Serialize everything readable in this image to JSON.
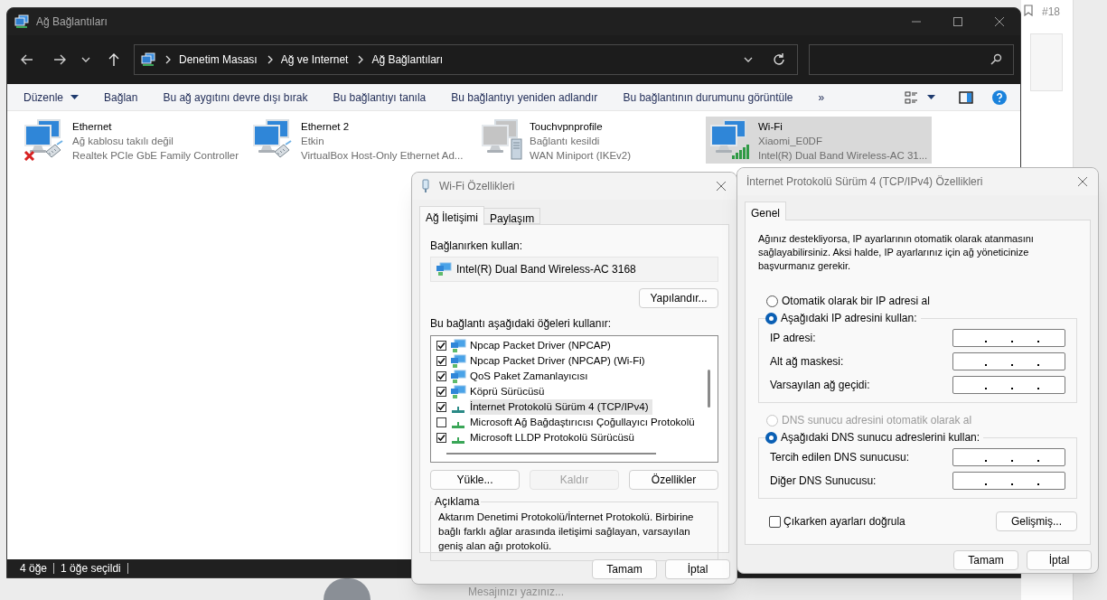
{
  "background": {
    "post_number": "#18",
    "message_placeholder": "Mesajınızı yazınız..."
  },
  "explorer": {
    "title": "Ağ Bağlantıları",
    "breadcrumb": [
      "Denetim Masası",
      "Ağ ve Internet",
      "Ağ Bağlantıları"
    ],
    "commands": [
      {
        "label": "Düzenle",
        "dropdown": true
      },
      {
        "label": "Bağlan",
        "dropdown": false
      },
      {
        "label": "Bu ağ aygıtını devre dışı bırak",
        "dropdown": false
      },
      {
        "label": "Bu bağlantıyı tanıla",
        "dropdown": false
      },
      {
        "label": "Bu bağlantıyı yeniden adlandır",
        "dropdown": false
      },
      {
        "label": "Bu bağlantının durumunu görüntüle",
        "dropdown": false
      },
      {
        "label": "»",
        "dropdown": false
      }
    ],
    "connections": [
      {
        "name": "Ethernet",
        "status": "Ağ kablosu takılı değil",
        "device": "Realtek PCIe GbE Family Controller",
        "kind": "ethernet-unplugged",
        "selected": false
      },
      {
        "name": "Ethernet 2",
        "status": "Etkin",
        "device": "VirtualBox Host-Only Ethernet Ad...",
        "kind": "ethernet",
        "selected": false
      },
      {
        "name": "Touchvpnprofile",
        "status": "Bağlantı kesildi",
        "device": "WAN Miniport (IKEv2)",
        "kind": "vpn",
        "selected": false
      },
      {
        "name": "Wi-Fi",
        "status": "Xiaomi_E0DF",
        "device": "Intel(R) Dual Band Wireless-AC 31...",
        "kind": "wifi",
        "selected": true
      }
    ],
    "status_bar": [
      "4 öğe",
      "1 öğe seçildi"
    ]
  },
  "wifi_dialog": {
    "title": "Wi-Fi Özellikleri",
    "tabs": [
      {
        "label": "Ağ İletişimi",
        "selected": true
      },
      {
        "label": "Paylaşım",
        "selected": false
      }
    ],
    "connect_using_label": "Bağlanırken kullan:",
    "adapter": "Intel(R) Dual Band Wireless-AC 3168",
    "configure_button": "Yapılandır...",
    "items_label": "Bu bağlantı aşağıdaki öğeleri kullanır:",
    "items": [
      {
        "label": "Npcap Packet Driver (NPCAP)",
        "checked": true,
        "selected": false,
        "kind": "service"
      },
      {
        "label": "Npcap Packet Driver (NPCAP) (Wi-Fi)",
        "checked": true,
        "selected": false,
        "kind": "service"
      },
      {
        "label": "QoS Paket Zamanlayıcısı",
        "checked": true,
        "selected": false,
        "kind": "service"
      },
      {
        "label": "Köprü Sürücüsü",
        "checked": true,
        "selected": false,
        "kind": "service"
      },
      {
        "label": "İnternet Protokolü Sürüm 4 (TCP/IPv4)",
        "checked": true,
        "selected": true,
        "kind": "protocol"
      },
      {
        "label": "Microsoft Ağ Bağdaştırıcısı Çoğullayıcı Protokolü",
        "checked": false,
        "selected": false,
        "kind": "protocol"
      },
      {
        "label": "Microsoft LLDP Protokolü Sürücüsü",
        "checked": true,
        "selected": false,
        "kind": "protocol"
      }
    ],
    "buttons": [
      {
        "label": "Yükle...",
        "disabled": false
      },
      {
        "label": "Kaldır",
        "disabled": true
      },
      {
        "label": "Özellikler",
        "disabled": false
      }
    ],
    "description": {
      "title": "Açıklama",
      "text": "Aktarım Denetimi Protokolü/İnternet Protokolü. Birbirine bağlı farklı ağlar arasında iletişimi sağlayan, varsayılan geniş alan ağı protokolü."
    },
    "footer_buttons": [
      "Tamam",
      "İptal"
    ]
  },
  "ipv4_dialog": {
    "title": "İnternet Protokolü Sürüm 4 (TCP/IPv4) Özellikleri",
    "tabs": [
      {
        "label": "Genel",
        "selected": true
      }
    ],
    "intro": "Ağınız destekliyorsa, IP ayarlarının otomatik olarak atanmasını sağlayabilirsiniz. Aksi halde, IP ayarlarınız için ağ yöneticinize başvurmanız gerekir.",
    "ip_options": [
      {
        "label": "Otomatik olarak bir IP adresi al",
        "selected": false,
        "disabled": false
      },
      {
        "label": "Aşağıdaki IP adresini kullan:",
        "selected": true,
        "disabled": false
      }
    ],
    "ip_fields": [
      "IP adresi:",
      "Alt ağ maskesi:",
      "Varsayılan ağ geçidi:"
    ],
    "dns_options": [
      {
        "label": "DNS sunucu adresini otomatik olarak al",
        "selected": false,
        "disabled": true
      },
      {
        "label": "Aşağıdaki DNS sunucu adreslerini kullan:",
        "selected": true,
        "disabled": false
      }
    ],
    "dns_fields": [
      "Tercih edilen DNS sunucusu:",
      "Diğer DNS Sunucusu:"
    ],
    "validate": {
      "label": "Çıkarken ayarları doğrula",
      "checked": false
    },
    "advanced_button": "Gelişmiş...",
    "footer_buttons": [
      "Tamam",
      "İptal"
    ]
  }
}
